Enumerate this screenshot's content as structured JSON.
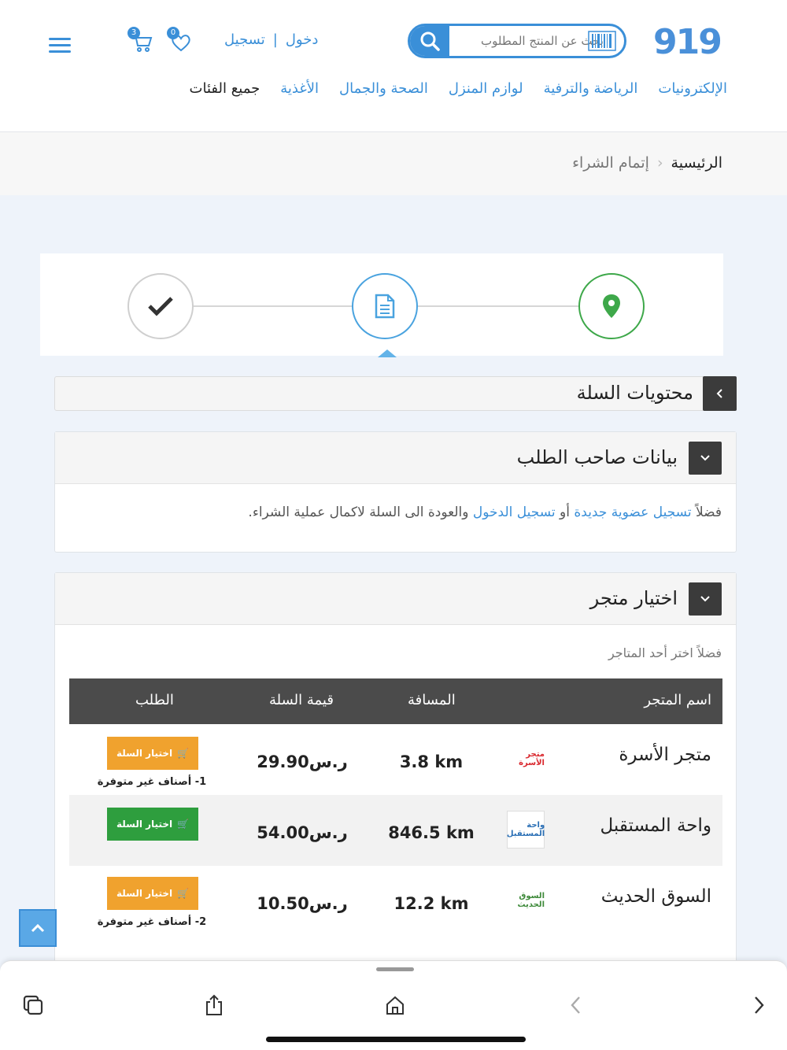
{
  "header": {
    "logo_text": "919",
    "search_placeholder": "بحث عن المنتج المطلوب",
    "login_label": "دخول",
    "register_label": "تسجيل",
    "cart_count": "3",
    "wishlist_count": "0"
  },
  "nav": {
    "items": [
      "جميع الفئات",
      "الأغذية",
      "الصحة والجمال",
      "لوازم المنزل",
      "الرياضة والترفية",
      "الإلكترونيات"
    ]
  },
  "breadcrumb": {
    "home": "الرئيسية",
    "separator": "‹",
    "current": "إتمام الشراء"
  },
  "steps": {
    "current_index": 1
  },
  "cart_panel": {
    "title": "محتويات السلة"
  },
  "customer_panel": {
    "title": "بيانات صاحب الطلب",
    "notice_prefix": "فضلاً",
    "register_link": "تسجيل عضوية جديدة",
    "or": "أو",
    "login_link": "تسجيل الدخول",
    "notice_suffix": "والعودة الى السلة لاكمال عملية الشراء."
  },
  "store_panel": {
    "title": "اختيار متجر",
    "hint": "فضلاً اختر أحد المتاجر",
    "columns": {
      "name": "اسم المتجر",
      "distance": "المسافة",
      "cart_value": "قيمة السلة",
      "order": "الطلب"
    },
    "rows": [
      {
        "name": "متجر الأسرة",
        "logo_text": "متجر الأسرة",
        "logo_color": "#d9262c",
        "distance": "3.8 km",
        "price": "29.90ر.س",
        "button": "اختيار السلة",
        "button_color": "orange",
        "note": "1- أصناف غير متوفرة"
      },
      {
        "name": "واحة المستقبل",
        "logo_text": "واحة المستقبل",
        "logo_color": "#2a6fb5",
        "distance": "846.5 km",
        "price": "54.00ر.س",
        "button": "اختيار السلة",
        "button_color": "green",
        "note": ""
      },
      {
        "name": "السوق الحديث",
        "logo_text": "السوق الحديث",
        "logo_color": "#3e8a3a",
        "distance": "12.2 km",
        "price": "10.50ر.س",
        "button": "اختيار السلة",
        "button_color": "orange",
        "note": "2- أصناف غير متوفرة"
      }
    ]
  },
  "colors": {
    "brand_blue": "#3a8fd8",
    "step_green": "#3ea84a",
    "button_orange": "#f0a22e",
    "button_green": "#2e9e3e",
    "table_header": "#4b4b4b"
  }
}
